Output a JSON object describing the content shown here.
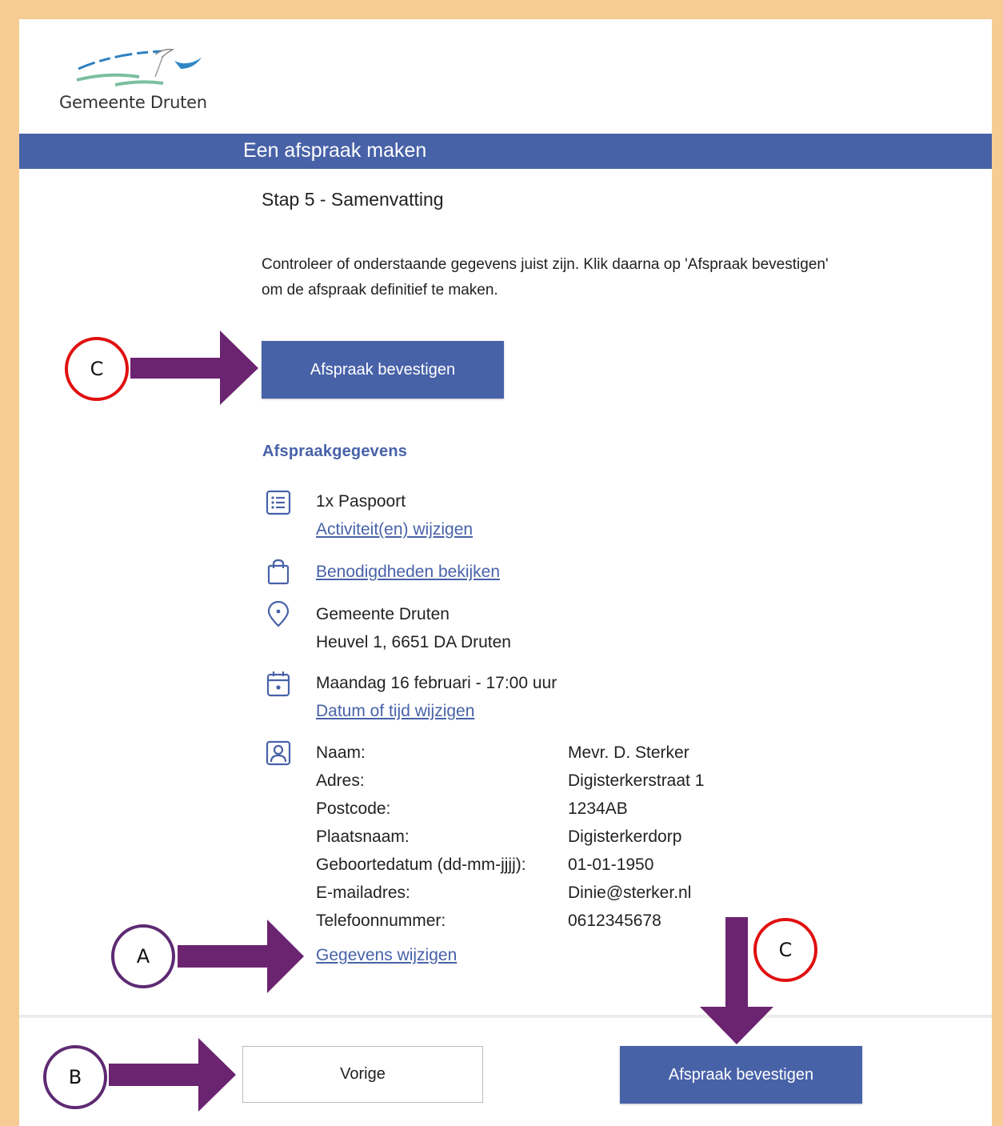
{
  "header": {
    "org_name": "Gemeente Druten"
  },
  "titlebar": {
    "title": "Een afspraak maken"
  },
  "step": {
    "title": "Stap 5 - Samenvatting"
  },
  "intro": {
    "text": "Controleer of onderstaande gegevens juist zijn. Klik daarna op 'Afspraak bevestigen' om de afspraak definitief te maken."
  },
  "confirm_button_top": {
    "label": "Afspraak bevestigen"
  },
  "details": {
    "section_title": "Afspraakgegevens",
    "activity": {
      "value": "1x Paspoort",
      "link": "Activiteit(en) wijzigen",
      "icon": "list-icon"
    },
    "requirements": {
      "link": "Benodigdheden bekijken",
      "icon": "shopping-bag-icon"
    },
    "location": {
      "name": "Gemeente Druten",
      "address": "Heuvel 1, 6651 DA Druten",
      "icon": "location-pin-icon"
    },
    "datetime": {
      "value": "Maandag 16 februari - 17:00 uur",
      "link": "Datum of tijd wijzigen",
      "icon": "calendar-icon"
    },
    "personal": {
      "icon": "contact-card-icon",
      "rows": [
        {
          "label": "Naam:",
          "value": "Mevr. D. Sterker"
        },
        {
          "label": "Adres:",
          "value": "Digisterkerstraat 1"
        },
        {
          "label": "Postcode:",
          "value": "1234AB"
        },
        {
          "label": "Plaatsnaam:",
          "value": "Digisterkerdorp"
        },
        {
          "label": "Geboortedatum (dd-mm-jjjj):",
          "value": "01-01-1950"
        },
        {
          "label": "E-mailadres:",
          "value": "Dinie@sterker.nl"
        },
        {
          "label": "Telefoonnummer:",
          "value": "0612345678"
        }
      ],
      "link": "Gegevens wijzigen"
    }
  },
  "footer": {
    "back_label": "Vorige",
    "confirm_label": "Afspraak bevestigen"
  },
  "annotations": {
    "c_top": "C",
    "a": "A",
    "b": "B",
    "c_bottom": "C",
    "arrow_color": "#6b2470",
    "red_circle_color": "#e01010",
    "purple_circle_color": "#5e2a72"
  },
  "colors": {
    "brand_blue": "#4862a8",
    "page_border": "#f6cb94"
  }
}
